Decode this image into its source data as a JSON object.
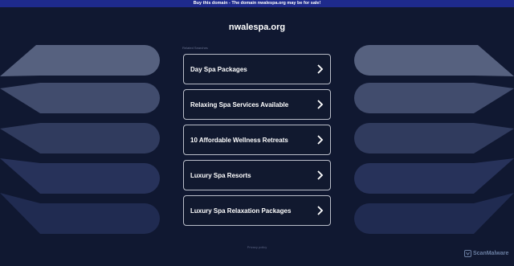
{
  "banner": {
    "text": "Buy this domain - The domain nwalespa.org may be for sale!"
  },
  "site": {
    "title": "nwalespa.org"
  },
  "related": {
    "label": "Related Searches"
  },
  "links": [
    {
      "label": "Day Spa Packages"
    },
    {
      "label": "Relaxing Spa Services Available"
    },
    {
      "label": "10 Affordable Wellness Retreats"
    },
    {
      "label": "Luxury Spa Resorts"
    },
    {
      "label": "Luxury Spa Relaxation Packages"
    }
  ],
  "footer": {
    "privacy": "Privacy policy"
  },
  "badge": {
    "text": "ScanMalware",
    "icon": "scanmalware-logo-icon"
  },
  "colors": {
    "background": "#101831",
    "banner": "#1e2a8c",
    "card_border": "#b9bdc8"
  }
}
